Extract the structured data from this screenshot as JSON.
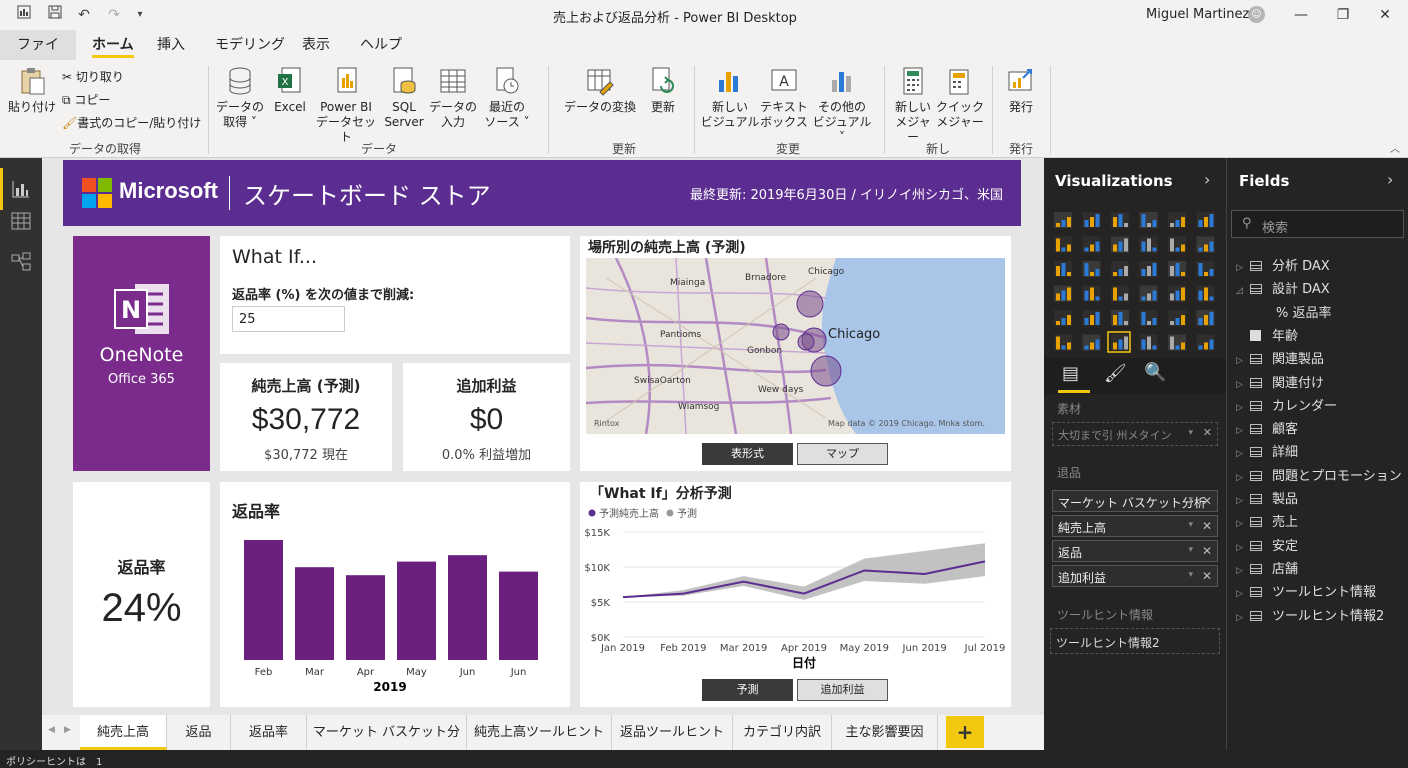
{
  "window": {
    "title": "売上および返品分析 - Power BI Desktop",
    "user": "Miguel Martinez"
  },
  "menu": {
    "tabs": [
      "ファイル",
      "ホーム",
      "挿入",
      "モデリング",
      "表示",
      "ヘルプ"
    ]
  },
  "ribbon": {
    "paste": "貼り付け",
    "cut": "切り取り",
    "copy": "コピー",
    "format_painter": "書式のコピー/貼り付け",
    "group_clipboard": "データの取得",
    "get_data": [
      "データの",
      "取得 ˅"
    ],
    "excel": "Excel",
    "pbi_dataset": [
      "Power BI",
      "データセット"
    ],
    "sql": [
      "SQL",
      "Server"
    ],
    "enter_data": [
      "データの",
      "入力"
    ],
    "recent_sources": [
      "最近の",
      "ソース ˅"
    ],
    "group_data": "データ",
    "transform": "データの変換",
    "refresh": "更新",
    "group_update": "更新",
    "new_visual": [
      "新しい",
      "ビジュアル"
    ],
    "text_box": [
      "テキスト",
      "ボックス"
    ],
    "other_visuals": [
      "その他の",
      "ビジュアル ˅"
    ],
    "group_change": "変更",
    "new_measure": [
      "新しい",
      "メジャー"
    ],
    "quick_measure": [
      "クイック",
      "メジャー"
    ],
    "group_new": "新し",
    "publish": "発行",
    "group_publish": "発行"
  },
  "banner": {
    "brand": "Microsoft",
    "store": "スケートボード ストア",
    "updated": "最終更新: 2019年6月30日 / イリノイ州シカゴ、米国"
  },
  "onenote": {
    "name": "OneNote",
    "suite": "Office 365"
  },
  "whatif": {
    "title": "What If...",
    "label": "返品率 (%) を次の値まで削減:",
    "value": "25"
  },
  "kpi_sales": {
    "title": "純売上高 (予測)",
    "value": "$30,772",
    "sub": "$30,772 現在"
  },
  "kpi_profit": {
    "title": "追加利益",
    "value": "$0",
    "sub": "0.0% 利益増加"
  },
  "map": {
    "title": "場所別の純売上高 (予測)",
    "labels": {
      "chicago": "Chicago",
      "chicago2": "Chicago",
      "brnadore": "Brnadore",
      "miainga": "Miainga",
      "pantioms": "Pantioms",
      "gonbon": "Gonbon",
      "swisaorton": "SwisaOarton",
      "wewdays": "Wew days",
      "wiamsog": "Wiamsog"
    },
    "attribution": "Map data © 2019 Chicago. Mnka stom.",
    "logo": "Rintox",
    "btn_table": "表形式",
    "btn_map": "マップ"
  },
  "return_kpi": {
    "title": "返品率",
    "value": "24%"
  },
  "bar_chart_title": "返品率",
  "line_chart_title": "「What If」分析予測",
  "line_buttons": {
    "forecast": "予測",
    "profit": "追加利益"
  },
  "chart_data": [
    {
      "type": "bar",
      "title": "返品率",
      "categories": [
        "Feb",
        "Mar",
        "Apr",
        "May",
        "Jun",
        "Jun"
      ],
      "values": [
        0.3,
        0.232,
        0.212,
        0.246,
        0.262,
        0.221
      ],
      "xlabel": "2019",
      "ylim": [
        0,
        0.35
      ]
    },
    {
      "type": "area",
      "title": "「What If」分析予測",
      "xlabel": "日付",
      "x": [
        "Jan 2019",
        "Feb 2019",
        "Mar 2019",
        "Apr 2019",
        "May 2019",
        "Jun 2019",
        "Jul 2019"
      ],
      "y_ticks": [
        "$0K",
        "$5K",
        "$10K",
        "$15K"
      ],
      "ylim": [
        0,
        15000
      ],
      "legend": [
        "予測純売上高",
        "予測"
      ],
      "series": [
        {
          "name": "予測純売上高",
          "values": [
            5700,
            6200,
            7900,
            6200,
            9500,
            9000,
            10800
          ]
        },
        {
          "name": "予測",
          "lower": [
            5700,
            5900,
            7300,
            5300,
            8000,
            7600,
            8700
          ],
          "upper": [
            5700,
            6700,
            8700,
            7200,
            11200,
            12300,
            13400
          ]
        }
      ],
      "colors": {
        "line": "#5c2d91",
        "band": "#b3b3b3"
      }
    }
  ],
  "viz_pane": {
    "title": "Visualizations",
    "sec_values": "素材",
    "placeholder": "大切まで引 州メタイン",
    "sec_filters": "退品",
    "fields": [
      "マーケット バスケット分析",
      "純売上高",
      "返品",
      "追加利益"
    ],
    "sec_tooltips": "ツールヒント情報",
    "tooltip_well": "ツールヒント情報2"
  },
  "fields_pane": {
    "title": "Fields",
    "search": "検索",
    "items": [
      {
        "label": "分析 DAX",
        "type": "table",
        "exp": "▷"
      },
      {
        "label": "設計 DAX",
        "type": "table",
        "exp": "◿"
      },
      {
        "label": "% 返品率",
        "type": "measure",
        "exp": ""
      },
      {
        "label": "年齢",
        "type": "check",
        "exp": ""
      },
      {
        "label": "関連製品",
        "type": "table",
        "exp": "▷"
      },
      {
        "label": "関連付け",
        "type": "table",
        "exp": "▷"
      },
      {
        "label": "カレンダー",
        "type": "table",
        "exp": "▷"
      },
      {
        "label": "顧客",
        "type": "table",
        "exp": "▷"
      },
      {
        "label": "詳細",
        "type": "table",
        "exp": "▷"
      },
      {
        "label": "問題とプロモーション",
        "type": "table",
        "exp": "▷"
      },
      {
        "label": "製品",
        "type": "table",
        "exp": "▷"
      },
      {
        "label": "売上",
        "type": "table",
        "exp": "▷"
      },
      {
        "label": "安定",
        "type": "table",
        "exp": "▷"
      },
      {
        "label": "店舗",
        "type": "table",
        "exp": "▷"
      },
      {
        "label": "ツールヒント情報",
        "type": "table",
        "exp": "▷"
      },
      {
        "label": "ツールヒント情報2",
        "type": "table",
        "exp": "▷"
      }
    ]
  },
  "page_tabs": [
    "純売上高",
    "返品",
    "返品率",
    "マーケット バスケット分析",
    "純売上高ツールヒント",
    "返品ツールヒント",
    "カテゴリ内訳",
    "主な影響要因"
  ],
  "status": "ポリシーヒントは　1",
  "colors": {
    "purple": "#5c2d91",
    "accent": "#f2c811",
    "pane": "#252423"
  }
}
